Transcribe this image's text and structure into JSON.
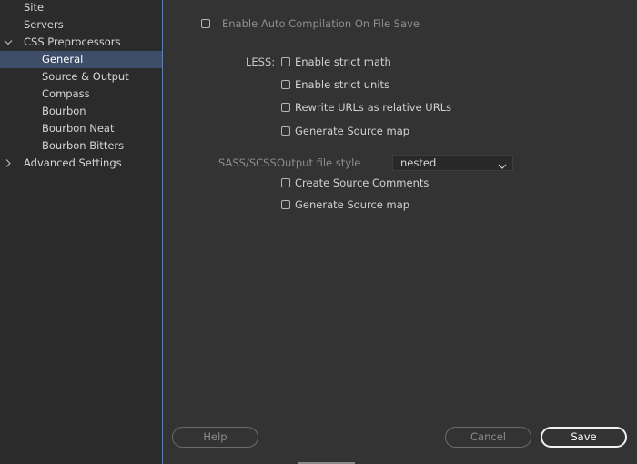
{
  "sidebar": {
    "items": [
      {
        "label": "Site"
      },
      {
        "label": "Servers"
      },
      {
        "label": "CSS Preprocessors",
        "expanded": true
      },
      {
        "label": "General",
        "selected": true
      },
      {
        "label": "Source & Output"
      },
      {
        "label": "Compass"
      },
      {
        "label": "Bourbon"
      },
      {
        "label": "Bourbon Neat"
      },
      {
        "label": "Bourbon Bitters"
      },
      {
        "label": "Advanced Settings",
        "expanded": false
      }
    ]
  },
  "main": {
    "auto_compile": {
      "label": "Enable Auto Compilation On File Save",
      "checked": false
    },
    "less": {
      "section_label": "LESS:",
      "options": [
        {
          "label": "Enable strict math",
          "checked": false
        },
        {
          "label": "Enable strict units",
          "checked": false
        },
        {
          "label": "Rewrite URLs as relative URLs",
          "checked": false
        },
        {
          "label": "Generate Source map",
          "checked": false
        }
      ]
    },
    "sass": {
      "section_label": "SASS/SCSS:",
      "output_style_label": "Output file style",
      "output_style_value": "nested",
      "options": [
        {
          "label": "Create Source Comments",
          "checked": false
        },
        {
          "label": "Generate Source map",
          "checked": false
        }
      ]
    }
  },
  "footer": {
    "help_label": "Help",
    "cancel_label": "Cancel",
    "save_label": "Save"
  },
  "colors": {
    "background": "#333333",
    "sidebar": "#2b2b2b",
    "selection": "#3e4e68",
    "divider": "#5a7fb3"
  },
  "icons": {
    "expanded": "chevron-down-icon",
    "collapsed": "chevron-right-icon",
    "dropdown": "chevron-down-icon"
  }
}
